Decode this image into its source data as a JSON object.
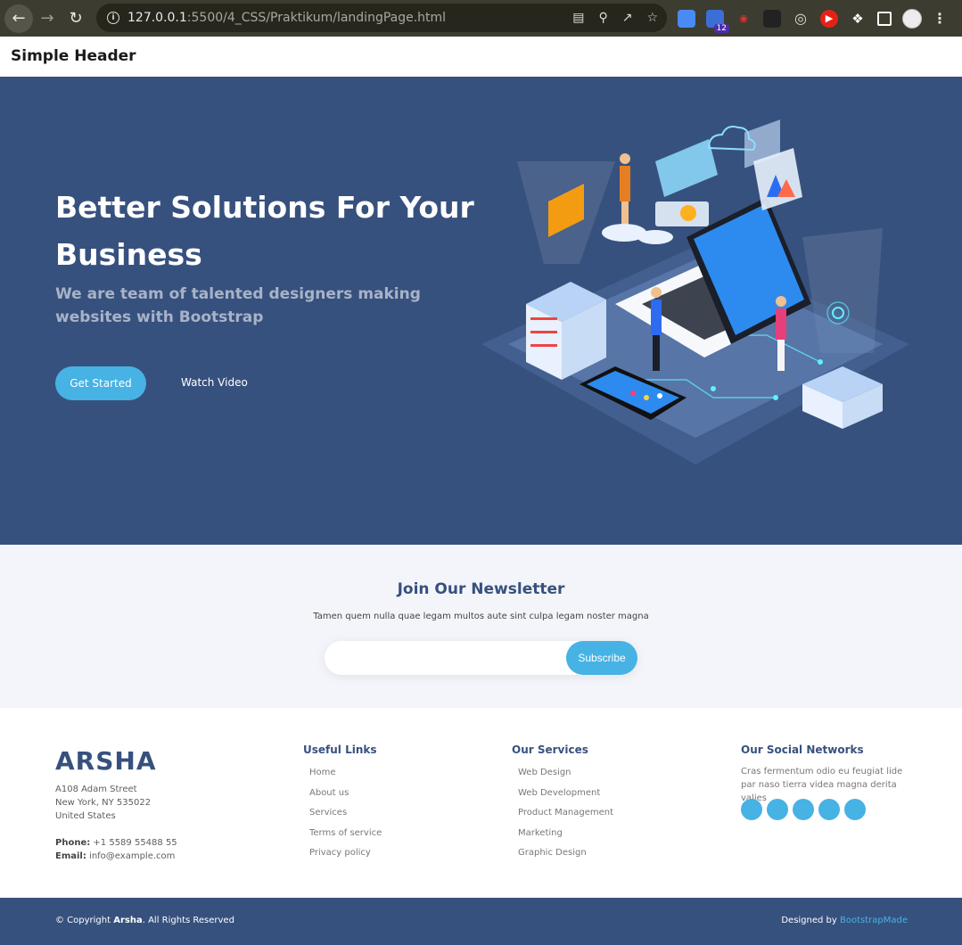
{
  "browser": {
    "url_host": "127.0.0.1",
    "url_rest": ":5500/4_CSS/Praktikum/landingPage.html",
    "extension_badge": "12"
  },
  "header": {
    "title": "Simple Header"
  },
  "hero": {
    "title": "Better Solutions For Your Business",
    "subtitle": "We are team of talented designers making websites with Bootstrap",
    "get_started": "Get Started",
    "watch_video": "Watch Video"
  },
  "newsletter": {
    "title": "Join Our Newsletter",
    "text": "Tamen quem nulla quae legam multos aute sint culpa legam noster magna",
    "input_value": "",
    "subscribe": "Subscribe"
  },
  "footer": {
    "brand": "ARSHA",
    "address": [
      "A108 Adam Street",
      "New York, NY 535022",
      "United States"
    ],
    "phone_label": "Phone:",
    "phone": "+1 5589 55488 55",
    "email_label": "Email:",
    "email": "info@example.com",
    "useful_links_title": "Useful Links",
    "useful_links": [
      "Home",
      "About us",
      "Services",
      "Terms of service",
      "Privacy policy"
    ],
    "services_title": "Our Services",
    "services": [
      "Web Design",
      "Web Development",
      "Product Management",
      "Marketing",
      "Graphic Design"
    ],
    "social_title": "Our Social Networks",
    "social_text": "Cras fermentum odio eu feugiat lide par naso tierra videa magna derita valies",
    "copyright_prefix": "© Copyright ",
    "copyright_brand": "Arsha",
    "copyright_suffix": ". All Rights Reserved",
    "designed_by": "Designed by ",
    "designer": "BootstrapMade"
  },
  "colors": {
    "primary": "#37517e",
    "accent": "#47b2e4",
    "newsletter_bg": "#f3f5fa"
  }
}
